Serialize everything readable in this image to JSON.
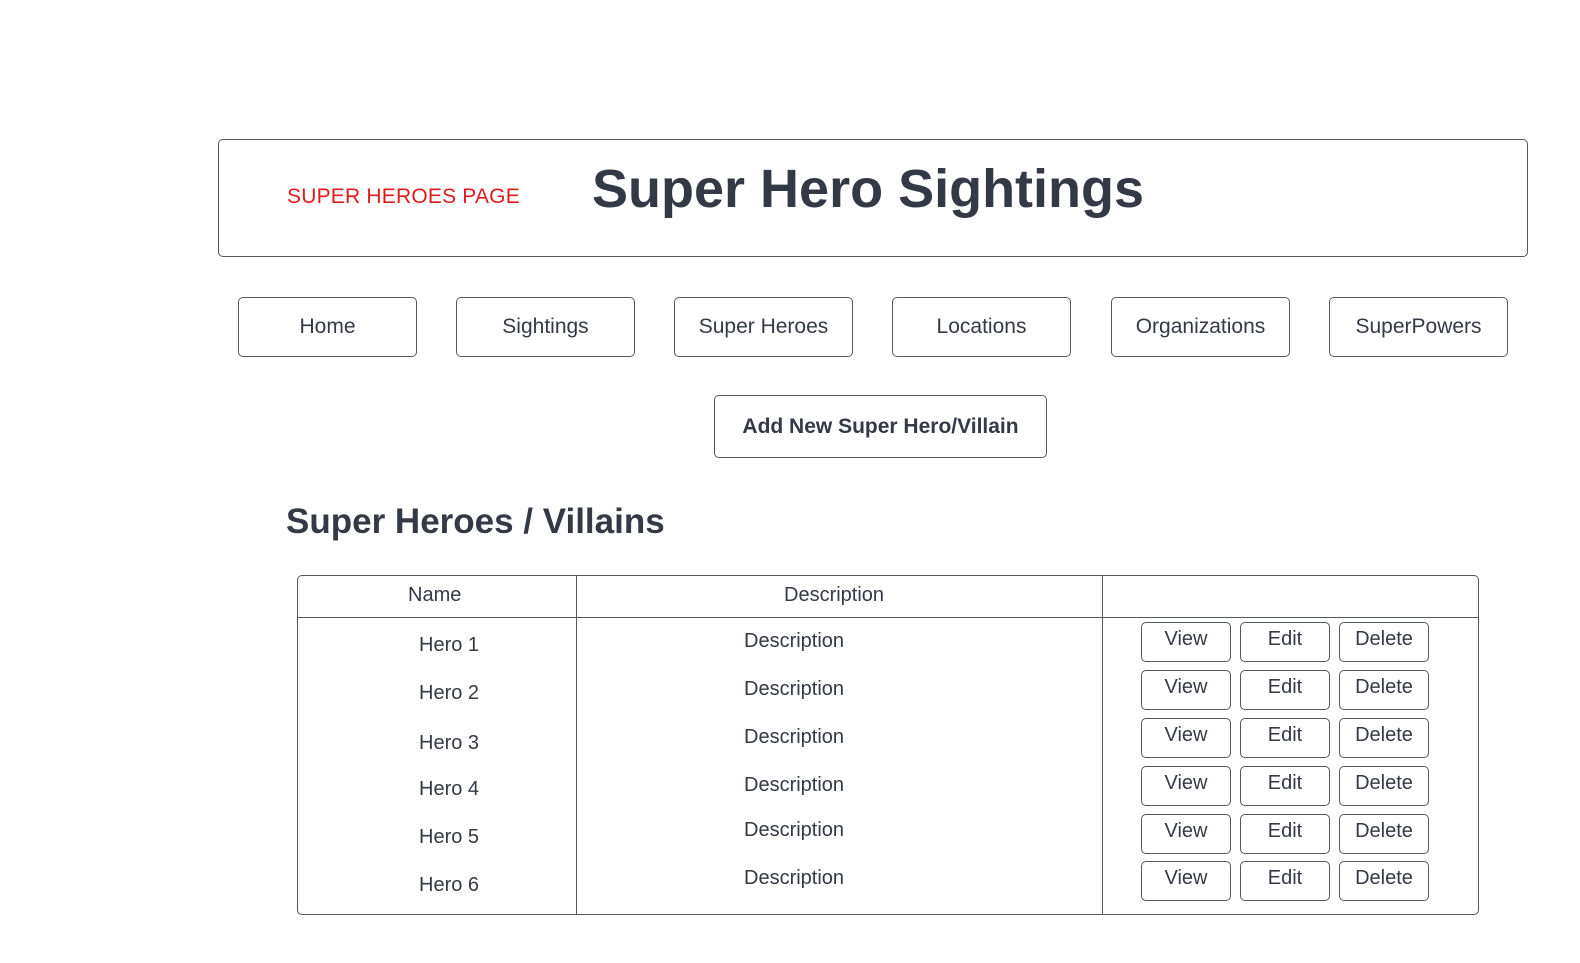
{
  "header": {
    "page_label": "SUPER HEROES PAGE",
    "title": "Super Hero Sightings"
  },
  "nav": [
    {
      "label": "Home"
    },
    {
      "label": "Sightings"
    },
    {
      "label": "Super Heroes"
    },
    {
      "label": "Locations"
    },
    {
      "label": "Organizations"
    },
    {
      "label": "SuperPowers"
    }
  ],
  "add_button_label": "Add New Super Hero/Villain",
  "section_title": "Super Heroes / Villains",
  "table": {
    "columns": [
      "Name",
      "Description",
      ""
    ],
    "actions": [
      "View",
      "Edit",
      "Delete"
    ],
    "rows": [
      {
        "name": "Hero 1",
        "description": "Description"
      },
      {
        "name": "Hero 2",
        "description": "Description"
      },
      {
        "name": "Hero 3",
        "description": "Description"
      },
      {
        "name": "Hero 4",
        "description": "Description"
      },
      {
        "name": "Hero 5",
        "description": "Description"
      },
      {
        "name": "Hero 6",
        "description": "Description"
      }
    ]
  },
  "colors": {
    "page_label": "#e01b1b",
    "text": "#333a45",
    "border": "#55595f",
    "background": "#ffffff"
  }
}
